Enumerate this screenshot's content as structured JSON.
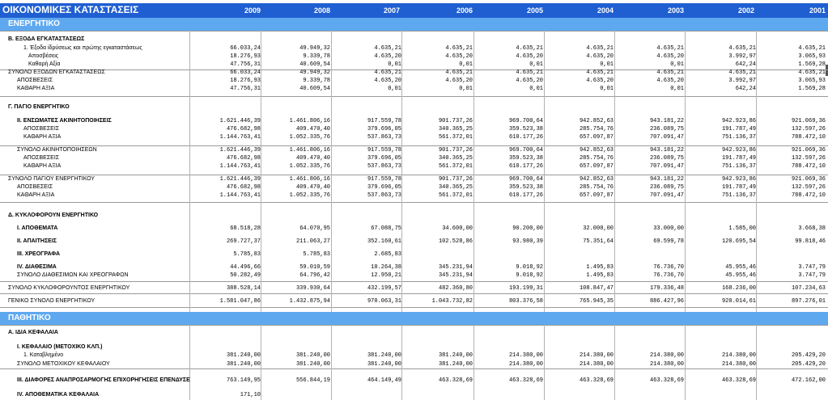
{
  "title": "ΟΙΚΟΝΟΜΙΚΕΣ ΚΑΤΑΣΤΑΣΕΙΣ",
  "years": [
    "2009",
    "2008",
    "2007",
    "2006",
    "2005",
    "2004",
    "2003",
    "2002",
    "2001"
  ],
  "bands": {
    "assets": "ΕΝΕΡΓΗΤΙΚΟ",
    "liabilities": "ΠΑΘΗΤΙΚΟ"
  },
  "rows": [
    {
      "label": "Β. ΕΞΟΔΑ ΕΓΚΑΤΑΣΤΑΣΕΩΣ",
      "indent": 0,
      "bold": true,
      "values": []
    },
    {
      "label": "1. Έξοδα ίδρύσεως και πρώτης εγκαταστάσεως",
      "indent": 2,
      "bold": false,
      "values": [
        "66.033,24",
        "49.949,32",
        "4.635,21",
        "4.635,21",
        "4.635,21",
        "4.635,21",
        "4.635,21",
        "4.635,21",
        "4.635,21"
      ]
    },
    {
      "label": "Αποσβέσεις",
      "indent": 3,
      "bold": false,
      "values": [
        "18.276,93",
        "9.339,78",
        "4.635,20",
        "4.635,20",
        "4.635,20",
        "4.635,20",
        "4.635,20",
        "3.992,97",
        "3.065,93"
      ]
    },
    {
      "label": "Καθαρή Αξία",
      "indent": 3,
      "bold": false,
      "values": [
        "47.756,31",
        "40.609,54",
        "0,01",
        "0,01",
        "0,01",
        "0,01",
        "0,01",
        "642,24",
        "1.569,28"
      ]
    },
    {
      "label": "ΣΥΝΟΛΟ ΕΞΟΔΩΝ ΕΓΚΑΤΑΣΤΑΣΕΩΣ",
      "indent": 0,
      "bold": false,
      "values": [
        "66.033,24",
        "49.949,32",
        "4.635,21",
        "4.635,21",
        "4.635,21",
        "4.635,21",
        "4.635,21",
        "4.635,21",
        "4.635,21"
      ]
    },
    {
      "label": "ΑΠΟΣΒΕΣΕΙΣ",
      "indent": 1,
      "bold": false,
      "values": [
        "18.276,93",
        "9.339,78",
        "4.635,20",
        "4.635,20",
        "4.635,20",
        "4.635,20",
        "4.635,20",
        "3.992,97",
        "3.065,93"
      ]
    },
    {
      "label": "ΚΑΘΑΡΗ ΑΞΙΑ",
      "indent": 1,
      "bold": false,
      "values": [
        "47.756,31",
        "40.609,54",
        "0,01",
        "0,01",
        "0,01",
        "0,01",
        "0,01",
        "642,24",
        "1.569,28"
      ]
    },
    {
      "label": "Γ. ΠΑΓΙΟ ΕΝΕΡΓΗΤΙΚΟ",
      "indent": 0,
      "bold": true,
      "values": []
    },
    {
      "label": "ΙΙ. ΕΝΣΩΜΑΤΕΣ ΑΚΙΝΗΤΟΠΟΙΗΣΕΙΣ",
      "indent": 1,
      "bold": true,
      "values": [
        "1.621.446,39",
        "1.461.806,16",
        "917.559,78",
        "901.737,26",
        "969.700,64",
        "942.852,63",
        "943.181,22",
        "942.923,86",
        "921.069,36"
      ]
    },
    {
      "label": "ΑΠΟΣΒΕΣΕΙΣ",
      "indent": 2,
      "bold": false,
      "values": [
        "476.682,98",
        "409.470,40",
        "379.696,05",
        "340.365,25",
        "359.523,38",
        "285.754,76",
        "236.089,75",
        "191.787,49",
        "132.597,26"
      ]
    },
    {
      "label": "ΚΑΘΑΡΗ ΑΞΙΑ",
      "indent": 2,
      "bold": false,
      "values": [
        "1.144.763,41",
        "1.052.335,76",
        "537.863,73",
        "561.372,01",
        "610.177,26",
        "657.097,87",
        "707.091,47",
        "751.136,37",
        "788.472,10"
      ]
    },
    {
      "label": "ΣΥΝΟΛΟ ΑΚΙΝΗΤΟΠΟΙΗΣΕΩΝ",
      "indent": 1,
      "bold": false,
      "values": [
        "1.621.446,39",
        "1.461.806,16",
        "917.559,78",
        "901.737,26",
        "969.700,64",
        "942.852,63",
        "943.181,22",
        "942.923,86",
        "921.069,36"
      ]
    },
    {
      "label": "ΑΠΟΣΒΕΣΕΙΣ",
      "indent": 2,
      "bold": false,
      "values": [
        "476.682,98",
        "409.470,40",
        "379.696,05",
        "340.365,25",
        "359.523,38",
        "285.754,76",
        "236.089,75",
        "191.787,49",
        "132.597,26"
      ]
    },
    {
      "label": "ΚΑΘΑΡΗ ΑΞΙΑ",
      "indent": 2,
      "bold": false,
      "values": [
        "1.144.763,41",
        "1.052.335,76",
        "537.863,73",
        "561.372,01",
        "610.177,26",
        "657.097,87",
        "707.091,47",
        "751.136,37",
        "788.472,10"
      ]
    },
    {
      "label": "ΣΥΝΟΛΟ ΠΑΓΙΟΥ ΕΝΕΡΓΗΤΙΚΟΥ",
      "indent": 0,
      "bold": false,
      "values": [
        "1.621.446,39",
        "1.461.806,16",
        "917.559,78",
        "901.737,26",
        "969.700,64",
        "942.852,63",
        "943.181,22",
        "942.923,86",
        "921.069,36"
      ]
    },
    {
      "label": "ΑΠΟΣΒΕΣΕΙΣ",
      "indent": 1,
      "bold": false,
      "values": [
        "476.682,98",
        "409.470,40",
        "379.696,05",
        "340.365,25",
        "359.523,38",
        "285.754,76",
        "236.089,75",
        "191.787,49",
        "132.597,26"
      ]
    },
    {
      "label": "ΚΑΘΑΡΗ ΑΞΙΑ",
      "indent": 1,
      "bold": false,
      "values": [
        "1.144.763,41",
        "1.052.335,76",
        "537.863,73",
        "561.372,01",
        "610.177,26",
        "657.097,87",
        "707.091,47",
        "751.136,37",
        "788.472,10"
      ]
    },
    {
      "label": "Δ. ΚΥΚΛΟΦΟΡΟΥΝ ΕΝΕΡΓΗΤΙΚΟ",
      "indent": 0,
      "bold": true,
      "values": []
    },
    {
      "label": "Ι. ΑΠΟΘΕΜΑΤΑ",
      "indent": 1,
      "bold": true,
      "values": [
        "68.518,28",
        "64.070,95",
        "67.088,75",
        "34.600,00",
        "90.200,00",
        "32.000,00",
        "33.000,00",
        "1.585,00",
        "3.668,38"
      ]
    },
    {
      "label": "ΙΙ. ΑΠΑΙΤΗΣΕΙΣ",
      "indent": 1,
      "bold": true,
      "values": [
        "269.727,37",
        "211.063,27",
        "352.160,61",
        "102.528,86",
        "93.980,39",
        "75.351,64",
        "69.599,78",
        "120.695,54",
        "99.818,46"
      ]
    },
    {
      "label": "ΙΙΙ. ΧΡΕΟΓΡΑΦΑ",
      "indent": 1,
      "bold": true,
      "values": [
        "5.785,83",
        "5.785,83",
        "2.685,83",
        "",
        "",
        "",
        "",
        "",
        ""
      ]
    },
    {
      "label": "ΙV. ΔΙΑΘΕΣΙΜΑ",
      "indent": 1,
      "bold": true,
      "values": [
        "44.496,66",
        "59.010,59",
        "10.264,38",
        "345.231,94",
        "9.018,92",
        "1.495,83",
        "76.736,70",
        "45.955,46",
        "3.747,79"
      ]
    },
    {
      "label": "ΣΥΝΟΛΟ ΔΙΑΘΕΣΙΜΩΝ ΚΑΙ ΧΡΕΟΓΡΑΦΩΝ",
      "indent": 1,
      "bold": false,
      "values": [
        "50.282,49",
        "64.796,42",
        "12.950,21",
        "345.231,94",
        "9.018,92",
        "1.495,83",
        "76.736,70",
        "45.955,46",
        "3.747,79"
      ]
    },
    {
      "label": "ΣΥΝΟΛΟ ΚΥΚΛΟΦΟΡΟΥΝΤΟΣ ΕΝΕΡΓΗΤΙΚΟΥ",
      "indent": 0,
      "bold": false,
      "values": [
        "388.528,14",
        "339.930,64",
        "432.199,57",
        "482.360,80",
        "193.199,31",
        "108.847,47",
        "179.336,48",
        "168.236,00",
        "107.234,63"
      ]
    },
    {
      "label": "ΓΕΝΙΚΟ ΣΥΝΟΛΟ ΕΝΕΡΓΗΤΙΚΟΥ",
      "indent": 0,
      "bold": false,
      "values": [
        "1.581.047,86",
        "1.432.875,94",
        "970.063,31",
        "1.043.732,82",
        "803.376,58",
        "765.945,35",
        "886.427,96",
        "920.014,61",
        "897.276,01"
      ]
    },
    {
      "label": "Α. ΙΔΙΑ ΚΕΦΑΛΑΙΑ",
      "indent": 0,
      "bold": true,
      "values": []
    },
    {
      "label": "Ι. ΚΕΦΑΛΑΙΟ (ΜΕΤΟΧΙΚΟ ΚΛΠ.)",
      "indent": 1,
      "bold": true,
      "values": []
    },
    {
      "label": "1. Καταβλημένο",
      "indent": 2,
      "bold": false,
      "values": [
        "381.240,00",
        "381.240,00",
        "381.240,00",
        "381.240,00",
        "214.380,00",
        "214.380,00",
        "214.380,00",
        "214.380,00",
        "205.429,20"
      ]
    },
    {
      "label": "ΣΥΝΟΛΟ ΜΕΤΟΧΙΚΟΥ ΚΕΦΑΛΑΙΟΥ",
      "indent": 1,
      "bold": false,
      "values": [
        "381.240,00",
        "381.240,00",
        "381.240,00",
        "381.240,00",
        "214.380,00",
        "214.380,00",
        "214.380,00",
        "214.380,00",
        "205.429,20"
      ]
    },
    {
      "label": "ΙΙΙ. ΔΙΑΦΟΡΕΣ ΑΝΑΠΡΟΣΑΡΜΟΓΗΣ ΕΠΙΧΟΡΗΓΗΣΕΙΣ ΕΠΕΝΔΥΣΕ",
      "indent": 1,
      "bold": true,
      "values": [
        "763.149,95",
        "556.844,19",
        "464.149,49",
        "463.328,69",
        "463.328,69",
        "463.328,69",
        "463.328,69",
        "463.328,69",
        "472.162,00"
      ]
    },
    {
      "label": "ΙV. ΑΠΟΘΕΜΑΤΙΚΑ ΚΕΦΑΛΑΙΑ",
      "indent": 1,
      "bold": true,
      "values": [
        "171,10",
        "",
        "",
        "",
        "",
        "",
        "",
        "",
        ""
      ]
    }
  ]
}
